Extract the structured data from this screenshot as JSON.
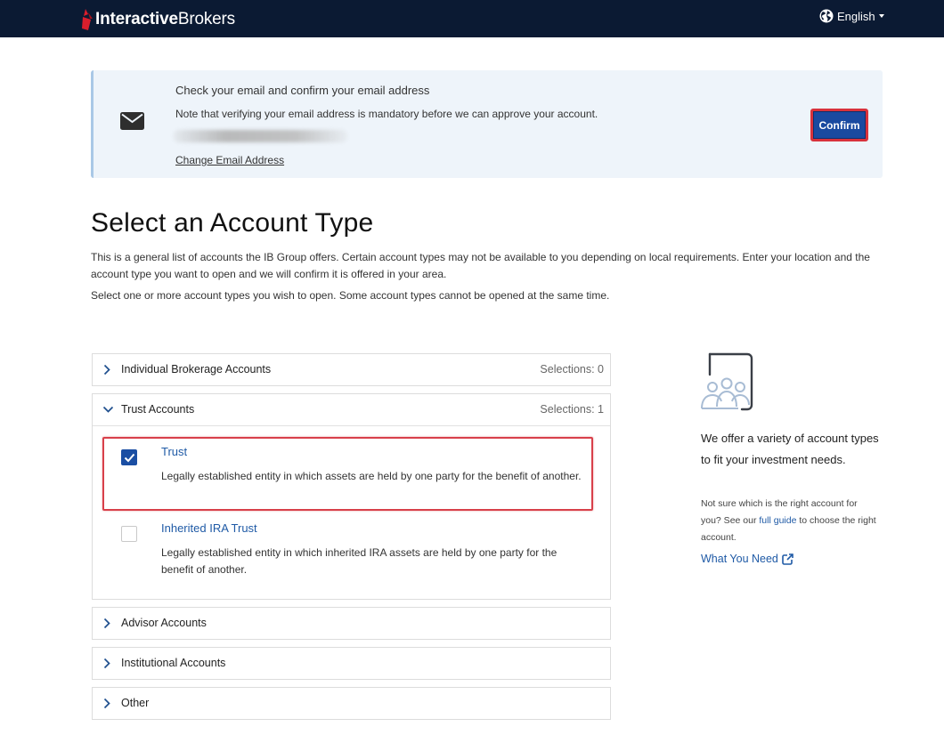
{
  "header": {
    "logo_bold": "Interactive",
    "logo_regular": "Brokers",
    "language": "English"
  },
  "email_banner": {
    "title": "Check your email and confirm your email address",
    "note": "Note that verifying your email address is mandatory before we can approve your account.",
    "change_link": "Change Email Address",
    "confirm_button": "Confirm"
  },
  "page": {
    "title": "Select an Account Type",
    "intro": "This is a general list of accounts the IB Group offers. Certain account types may not be available to you depending on local requirements. Enter your location and the account type you want to open and we will confirm it is offered in your area.",
    "instruction": "Select one or more account types you wish to open. Some account types cannot be opened at the same time."
  },
  "accordion": {
    "individual": {
      "title": "Individual Brokerage Accounts",
      "count": "Selections: 0"
    },
    "trust": {
      "title": "Trust Accounts",
      "count": "Selections: 1",
      "options": [
        {
          "title": "Trust",
          "desc": "Legally established entity in which assets are held by one party for the benefit of another.",
          "checked": true
        },
        {
          "title": "Inherited IRA Trust",
          "desc": "Legally established entity in which inherited IRA assets are held by one party for the benefit of another.",
          "checked": false
        }
      ]
    },
    "advisor": {
      "title": "Advisor Accounts"
    },
    "institutional": {
      "title": "Institutional Accounts"
    },
    "other": {
      "title": "Other"
    }
  },
  "side_panel": {
    "headline": "We offer a variety of account types to fit your investment needs.",
    "small_before": "Not sure which is the right account for you? See our ",
    "small_link": "full guide",
    "small_after": " to choose the right account.",
    "what_you_need": "What You Need"
  },
  "colors": {
    "topbar": "#0b1a33",
    "banner_bg": "#eef4fa",
    "primary": "#1a4aa0",
    "link": "#1f5aa6",
    "highlight": "#d8404a"
  }
}
